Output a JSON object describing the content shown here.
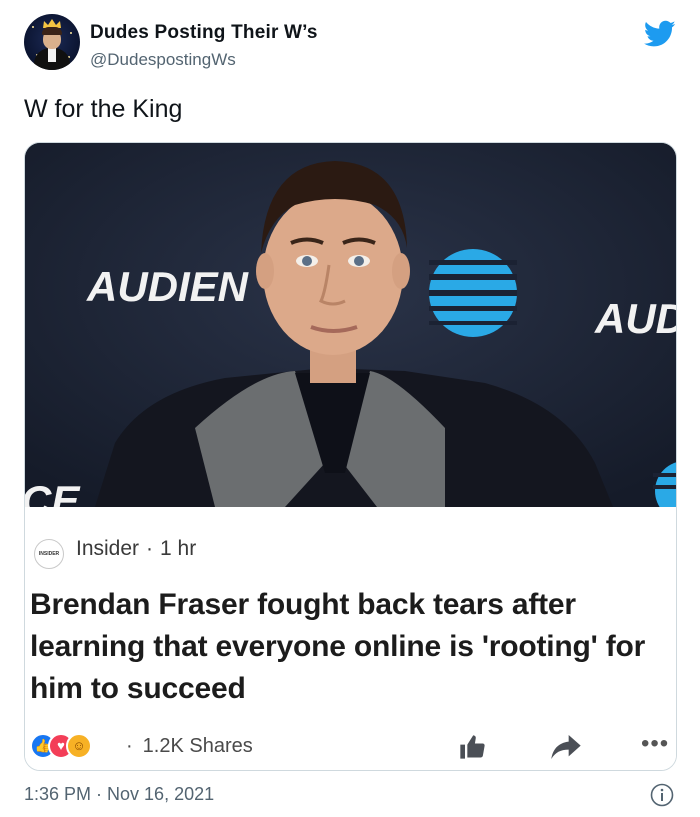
{
  "author": {
    "display_name": "Dudes Posting Their W’s",
    "handle": "@DudespostingWs"
  },
  "tweet": {
    "text": "W for the King",
    "timestamp": "1:36 PM · Nov 16, 2021"
  },
  "embedded_post": {
    "photo_text": {
      "backdrop_left": "AUDIEN",
      "backdrop_right": "AUD",
      "backdrop_corner": "CE"
    },
    "source_logo_text": "INSIDER",
    "source": "Insider",
    "separator": "·",
    "age": "1 hr",
    "headline": "Brendan Fraser fought back tears after learning that everyone online is 'rooting' for him to succeed",
    "shares": "1.2K Shares"
  },
  "icons": {
    "twitter": "twitter-bird-icon",
    "like_reaction": "like-reaction-icon",
    "love_reaction": "love-reaction-icon",
    "care_reaction": "care-reaction-icon",
    "thumb_up": "thumbs-up-icon",
    "share": "share-arrow-icon",
    "more": "more-options-icon",
    "info": "info-icon"
  },
  "colors": {
    "twitter_blue": "#1d9bf0",
    "like_blue": "#1877f2",
    "love_red": "#f33e58",
    "care_yellow": "#f7b125",
    "att_blue": "#2aa9e6"
  }
}
